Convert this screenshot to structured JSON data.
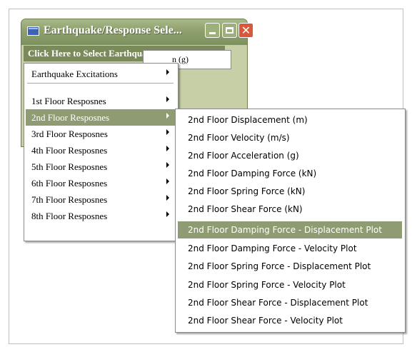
{
  "window": {
    "title": "Earthquake/Response Sele...",
    "menubar_label": "Click Here to Select Earthquake/Response",
    "field_text": "n (g)"
  },
  "main_menu": {
    "items": [
      "Earthquake Excitations",
      "1st Floor Resposnes",
      "2nd Floor Resposnes",
      "3rd Floor Resposnes",
      "4th Floor Resposnes",
      "5th Floor Resposnes",
      "6th Floor Resposnes",
      "7th Floor Resposnes",
      "8th Floor Resposnes"
    ],
    "selected": "2nd Floor Resposnes"
  },
  "submenu": {
    "items": [
      "2nd Floor Displacement (m)",
      "2nd Floor Velocity (m/s)",
      "2nd Floor Acceleration (g)",
      "2nd Floor Damping Force (kN)",
      "2nd Floor Spring Force (kN)",
      "2nd Floor Shear Force (kN)",
      "2nd Floor Damping Force - Displacement Plot",
      "2nd Floor Damping Force - Velocity Plot",
      "2nd Floor Spring Force - Displacement Plot",
      "2nd Floor Spring Force - Velocity Plot",
      "2nd Floor Shear Force - Displacement Plot",
      "2nd Floor Shear Force - Velocity Plot"
    ],
    "selected": "2nd Floor Damping Force - Displacement Plot"
  },
  "colors": {
    "highlight": "#8f9b72",
    "menubar": "#7a8a59",
    "close": "#d9583b"
  }
}
